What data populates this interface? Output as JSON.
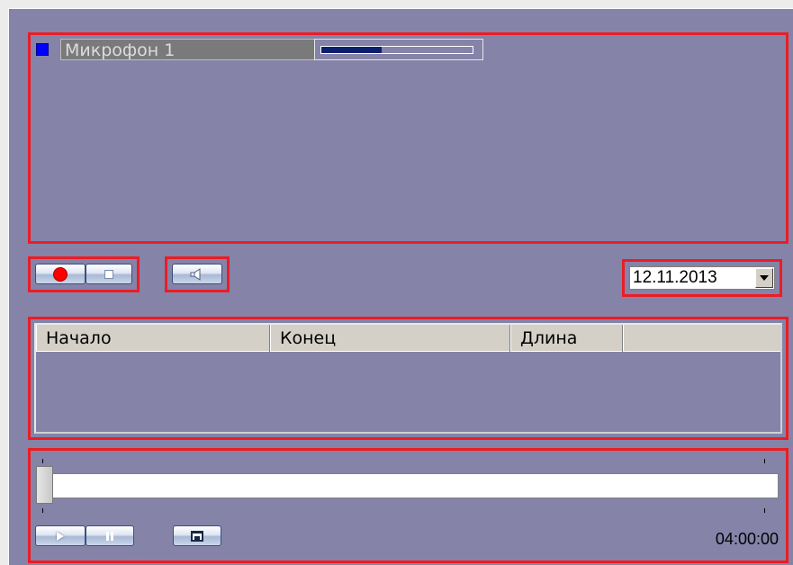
{
  "microphone": {
    "name": "Микрофон 1",
    "color": "#0000ff",
    "level_fraction": 0.4
  },
  "controls": {
    "record_icon": "record-icon",
    "stop_icon": "stop-icon",
    "speaker_icon": "speaker-icon",
    "record_color": "#ff0000"
  },
  "date": {
    "value": "12.11.2013"
  },
  "records_table": {
    "columns": [
      "Начало",
      "Конец",
      "Длина",
      ""
    ],
    "rows": []
  },
  "playback": {
    "position_fraction": 0.0,
    "duration": "04:00:00",
    "play_icon": "play-icon",
    "pause_icon": "pause-icon",
    "save_icon": "save-icon"
  },
  "colors": {
    "panel_bg": "#8583a8",
    "highlight_border": "#ec1c24"
  }
}
